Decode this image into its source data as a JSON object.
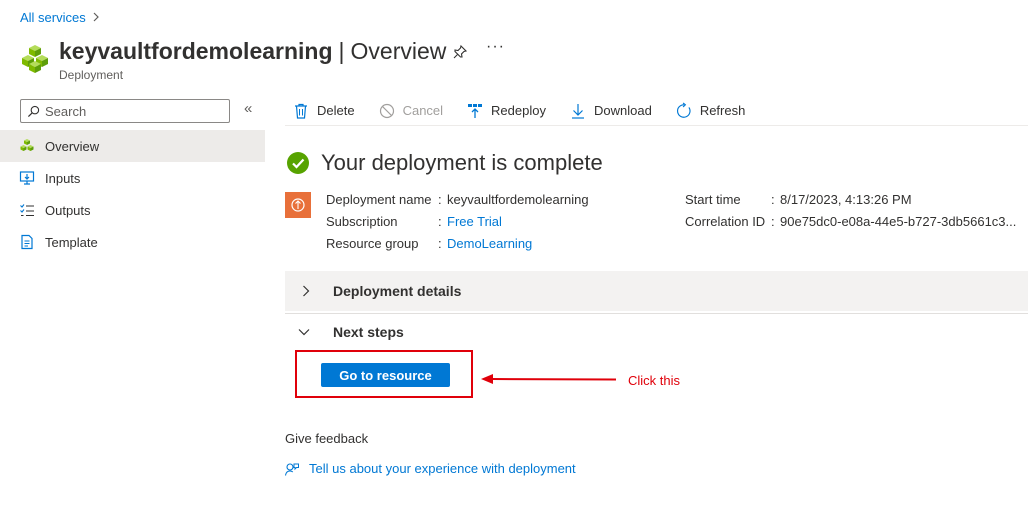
{
  "breadcrumb": {
    "root": "All services"
  },
  "header": {
    "resource_name": "keyvaultfordemolearning",
    "separator": "|",
    "section": "Overview",
    "subtitle": "Deployment",
    "more": "···"
  },
  "sidebar": {
    "search_placeholder": "Search",
    "collapse": "«",
    "items": [
      {
        "label": "Overview",
        "icon": "overview-icon",
        "active": true
      },
      {
        "label": "Inputs",
        "icon": "inputs-icon"
      },
      {
        "label": "Outputs",
        "icon": "outputs-icon"
      },
      {
        "label": "Template",
        "icon": "template-icon"
      }
    ]
  },
  "toolbar": {
    "delete": "Delete",
    "cancel": "Cancel",
    "redeploy": "Redeploy",
    "download": "Download",
    "refresh": "Refresh"
  },
  "status": {
    "text": "Your deployment is complete"
  },
  "info": {
    "deployment_name_label": "Deployment name",
    "deployment_name": "keyvaultfordemolearning",
    "subscription_label": "Subscription",
    "subscription": "Free Trial",
    "resource_group_label": "Resource group",
    "resource_group": "DemoLearning",
    "start_time_label": "Start time",
    "start_time": "8/17/2023, 4:13:26 PM",
    "correlation_id_label": "Correlation ID",
    "correlation_id": "90e75dc0-e08a-44e5-b727-3db5661c3...",
    "colon": ":"
  },
  "sections": {
    "details": "Deployment details",
    "next_steps": "Next steps"
  },
  "actions": {
    "go_to_resource": "Go to resource"
  },
  "annotation": {
    "text": "Click this"
  },
  "feedback": {
    "title": "Give feedback",
    "link": "Tell us about your experience with deployment"
  },
  "colors": {
    "accent": "#0078d4",
    "success": "#57a300",
    "annotation": "#e0000a",
    "resource_icon_bg": "#e8703a"
  }
}
